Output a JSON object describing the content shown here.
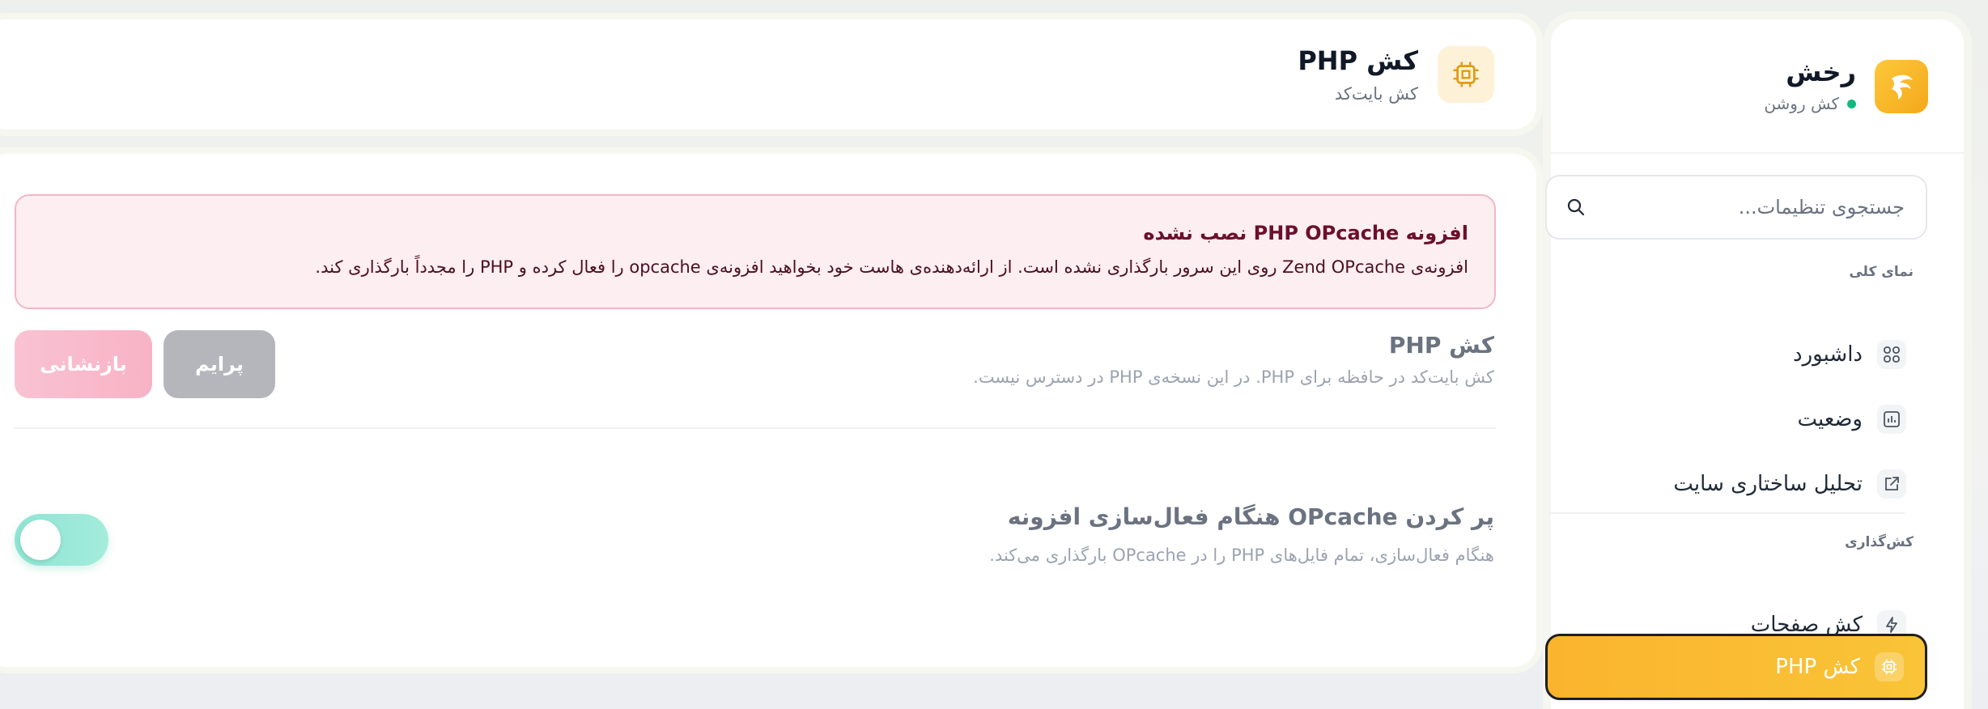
{
  "brand": {
    "name": "رخش",
    "status": "کش روشن",
    "status_color": "#10b981",
    "accent": "#f9b52c"
  },
  "search": {
    "placeholder": "جستجوی تنظیمات..."
  },
  "sidebar": {
    "section_overview": "نمای کلی",
    "section_caching": "کش‌گذاری",
    "items": [
      {
        "label": "داشبورد",
        "icon": "grid-icon"
      },
      {
        "label": "وضعیت",
        "icon": "chart-icon"
      },
      {
        "label": "تحلیل ساختاری سایت",
        "icon": "external-link-icon"
      },
      {
        "label": "کش صفحات",
        "icon": "lightning-icon"
      },
      {
        "label": "کش PHP",
        "icon": "chip-icon",
        "active": true
      }
    ]
  },
  "header": {
    "title": "کش PHP",
    "subtitle": "کش بایت‌کد",
    "icon": "chip-icon"
  },
  "alert": {
    "title": "افزونه PHP OPcache نصب نشده",
    "body": "افزونه‌ی Zend OPcache روی این سرور بارگذاری نشده است. از ارائه‌دهنده‌ی هاست خود بخواهید افزونه‌ی opcache را فعال کرده و PHP را مجدداً بارگذاری کند."
  },
  "php_cache": {
    "title": "کش PHP",
    "description": "کش بایت‌کد در حافظه برای PHP. در این نسخه‌ی PHP در دسترس نیست.",
    "prime_label": "پرایم",
    "reset_label": "بازنشانی"
  },
  "opcache_fill": {
    "title": "پر کردن OPcache هنگام فعال‌سازی افزونه",
    "description": "هنگام فعال‌سازی، تمام فایل‌های PHP را در OPcache بارگذاری می‌کند.",
    "enabled": false
  }
}
